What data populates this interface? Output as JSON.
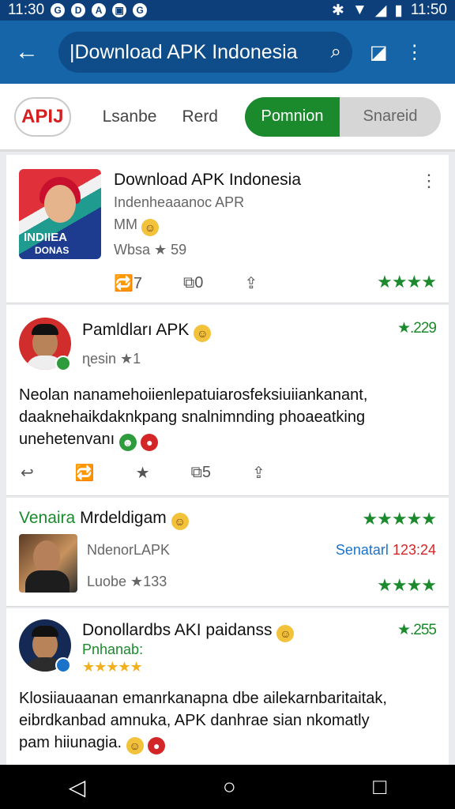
{
  "status_bar": {
    "time_left": "11:30",
    "time_right": "11:50",
    "notif_icons": [
      "G",
      "D",
      "A",
      "▣",
      "G"
    ]
  },
  "app_bar": {
    "search_text": "|Download APK Indonesia"
  },
  "chips": {
    "logo": "APIJ",
    "c1": "Lsanbe",
    "c2": "Rerd",
    "seg_on": "Pomnion",
    "seg_off": "Snareid"
  },
  "cards": [
    {
      "title": "Download APK Indonesia",
      "subtitle": "Indenheaaanoc APR",
      "meta": "MM",
      "rating_text": "Wbsa ★ 59",
      "thumb_line1": "INDIIEA",
      "thumb_line2": "DONAS",
      "actions": [
        "🔁7",
        "⧉0",
        "⇪"
      ],
      "stars": "★★★★"
    },
    {
      "author": "Pamldları APK",
      "score": "★.229",
      "handle": "ɳesin ★1",
      "body": "Neolan nanamehoiienlepatuiarosfeksiuiiankanant, daaknehaikdaknkpang snalnimnding phoaeatking unehetenvanı",
      "actions": [
        "↩",
        "🔁",
        "★",
        "⧉5",
        "⇪"
      ]
    },
    {
      "title_green": "Venaira",
      "title_rest": "Mrdeldigam",
      "stars_top": "★★★★★",
      "subtitle": "NdenorLAPK",
      "link": "Senatarl",
      "link_num": "123:24",
      "rating_text": "Luobe ★133",
      "stars_bottom": "★★★★"
    },
    {
      "author": "Donollardbs AKI paidanss",
      "score": "★.255",
      "handle": "Pnhanab:",
      "user_stars": "★★★★★",
      "body_line1": "Klosiiauaanan emanrkanapna dbe ailekarnbaritaitak,",
      "body_line2": "eibrdkanbad amnuka, APK danhrae sian nkomatly",
      "body_line3": "pam hiiunagia."
    }
  ]
}
